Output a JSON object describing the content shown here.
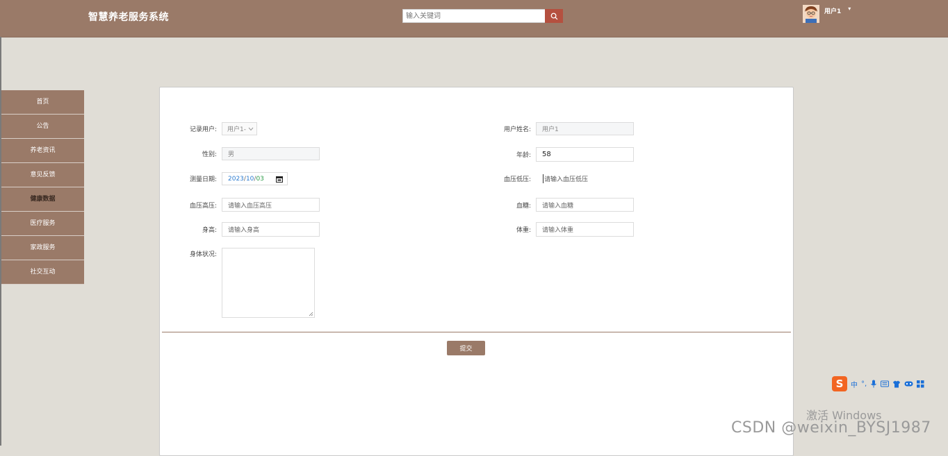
{
  "header": {
    "brand": "智慧养老服务系统",
    "search_placeholder": "输入关键词",
    "user_name": "用户1",
    "caret": "▾"
  },
  "sidebar": {
    "items": [
      {
        "label": "首页"
      },
      {
        "label": "公告"
      },
      {
        "label": "养老资讯"
      },
      {
        "label": "意见反馈"
      },
      {
        "label": "健康数据",
        "active": true
      },
      {
        "label": "医疗服务"
      },
      {
        "label": "家政服务"
      },
      {
        "label": "社交互动"
      }
    ]
  },
  "form": {
    "record_user": {
      "label": "记录用户:",
      "value": "用户1-"
    },
    "user_name": {
      "label": "用户姓名:",
      "value": "用户1"
    },
    "gender": {
      "label": "性别:",
      "value": "男"
    },
    "age": {
      "label": "年龄:",
      "value": "58"
    },
    "measure_date": {
      "label": "测量日期:",
      "year": "2023",
      "month": "10",
      "day": "03",
      "sep": "/"
    },
    "bp_low": {
      "label": "血压低压:",
      "placeholder": "请输入血压低压"
    },
    "bp_high": {
      "label": "血压高压:",
      "placeholder": "请输入血压高压"
    },
    "blood_sugar": {
      "label": "血糖:",
      "placeholder": "请输入血糖"
    },
    "height": {
      "label": "身高:",
      "placeholder": "请输入身高"
    },
    "weight": {
      "label": "体重:",
      "placeholder": "请输入体重"
    },
    "body_status": {
      "label": "身体状况:",
      "value": ""
    },
    "submit_label": "提交"
  },
  "ime_toolbar": {
    "logo": "S",
    "mode": "中",
    "punct": "°,"
  },
  "watermarks": {
    "windows": "激活 Windows",
    "csdn": "CSDN @weixin_BYSJ1987"
  }
}
